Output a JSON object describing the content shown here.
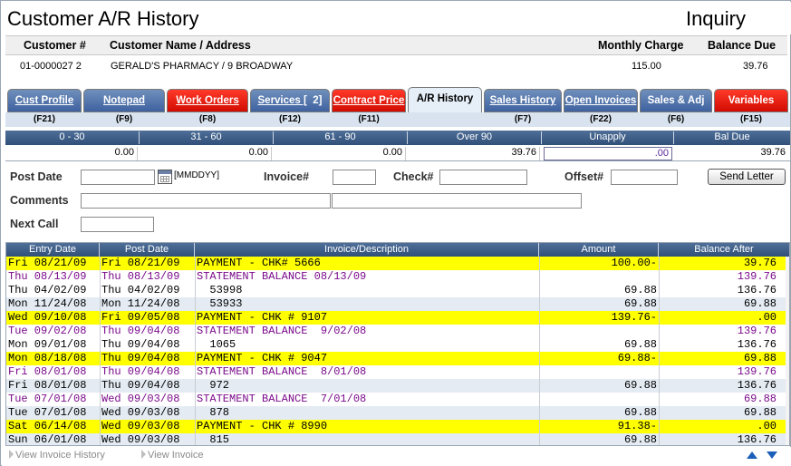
{
  "window": {
    "title": "Customer A/R History",
    "mode": "Inquiry"
  },
  "customer": {
    "headers": {
      "number": "Customer #",
      "name": "Customer Name / Address",
      "monthly_charge": "Monthly Charge",
      "balance_due": "Balance Due"
    },
    "number": "01-0000027 2",
    "name_address": "GERALD'S PHARMACY  /  9 BROADWAY",
    "monthly_charge": "115.00",
    "balance_due": "39.76"
  },
  "tabs": [
    {
      "label": "Cust Profile",
      "fkey": "(F21)"
    },
    {
      "label": "Notepad",
      "fkey": "(F9)"
    },
    {
      "label": "Work Orders",
      "fkey": "(F8)"
    },
    {
      "label": "Services [",
      "badge": "2]",
      "fkey": "(F12)"
    },
    {
      "label": "Contract Price",
      "fkey": "(F11)"
    },
    {
      "label": "A/R History",
      "fkey": ""
    },
    {
      "label": "Sales History",
      "fkey": "(F7)"
    },
    {
      "label": "Open Invoices",
      "fkey": "(F22)"
    },
    {
      "label": "Sales & Adj",
      "fkey": "(F6)"
    },
    {
      "label": "Variables",
      "fkey": "(F15)"
    }
  ],
  "aging": {
    "headers": [
      "0 - 30",
      "31 - 60",
      "61 - 90",
      "Over 90",
      "Unapply",
      "Bal Due"
    ],
    "values": [
      "0.00",
      "0.00",
      "0.00",
      "39.76",
      ".00",
      "39.76"
    ]
  },
  "form": {
    "post_date_label": "Post Date",
    "post_date_value": "",
    "date_format_hint": "[MMDDYY]",
    "invoice_label": "Invoice#",
    "invoice_value": "",
    "check_label": "Check#",
    "check_value": "",
    "offset_label": "Offset#",
    "offset_value": "",
    "send_letter_label": "Send Letter",
    "comments_label": "Comments",
    "comments_value_1": "",
    "comments_value_2": "",
    "next_call_label": "Next Call",
    "next_call_value": ""
  },
  "grid": {
    "headers": [
      "Entry Date",
      "Post Date",
      "Invoice/Description",
      "Amount",
      "Balance After"
    ],
    "rows": [
      {
        "entry": "Fri 08/21/09",
        "post": "Fri 08/21/09",
        "desc": "PAYMENT - CHK# 5666",
        "amount": "100.00-",
        "balance": "39.76",
        "style": "yellow"
      },
      {
        "entry": "Thu 08/13/09",
        "post": "Thu 08/13/09",
        "desc": "STATEMENT BALANCE 08/13/09",
        "amount": "",
        "balance": "139.76",
        "style": "stmt"
      },
      {
        "entry": "Thu 04/02/09",
        "post": "Thu 04/02/09",
        "desc": "  53998",
        "amount": "69.88",
        "balance": "136.76",
        "style": "norm"
      },
      {
        "entry": "Mon 11/24/08",
        "post": "Mon 11/24/08",
        "desc": "  53933",
        "amount": "69.88",
        "balance": "69.88",
        "style": "alt"
      },
      {
        "entry": "Wed 09/10/08",
        "post": "Fri 09/05/08",
        "desc": "PAYMENT - CHK # 9107",
        "amount": "139.76-",
        "balance": ".00",
        "style": "yellow"
      },
      {
        "entry": "Tue 09/02/08",
        "post": "Thu 09/04/08",
        "desc": "STATEMENT BALANCE  9/02/08",
        "amount": "",
        "balance": "139.76",
        "style": "stmt"
      },
      {
        "entry": "Mon 09/01/08",
        "post": "Thu 09/04/08",
        "desc": "  1065",
        "amount": "69.88",
        "balance": "136.76",
        "style": "norm"
      },
      {
        "entry": "Mon 08/18/08",
        "post": "Thu 09/04/08",
        "desc": "PAYMENT - CHK # 9047",
        "amount": "69.88-",
        "balance": "69.88",
        "style": "yellow"
      },
      {
        "entry": "Fri 08/01/08",
        "post": "Thu 09/04/08",
        "desc": "STATEMENT BALANCE  8/01/08",
        "amount": "",
        "balance": "139.76",
        "style": "stmt"
      },
      {
        "entry": "Fri 08/01/08",
        "post": "Thu 09/04/08",
        "desc": "  972",
        "amount": "69.88",
        "balance": "136.76",
        "style": "alt"
      },
      {
        "entry": "Tue 07/01/08",
        "post": "Wed 09/03/08",
        "desc": "STATEMENT BALANCE  7/01/08",
        "amount": "",
        "balance": "69.88",
        "style": "stmt"
      },
      {
        "entry": "Tue 07/01/08",
        "post": "Wed 09/03/08",
        "desc": "  878",
        "amount": "69.88",
        "balance": "69.88",
        "style": "alt"
      },
      {
        "entry": "Sat 06/14/08",
        "post": "Wed 09/03/08",
        "desc": "PAYMENT - CHK # 8990",
        "amount": "91.38-",
        "balance": ".00",
        "style": "yellow"
      },
      {
        "entry": "Sun 06/01/08",
        "post": "Wed 09/03/08",
        "desc": "  815",
        "amount": "69.88",
        "balance": "136.76",
        "style": "alt"
      }
    ]
  },
  "footer": {
    "view_history_label": "View Invoice History",
    "view_invoice_label": "View Invoice",
    "up_icon": "arrow-up-icon",
    "down_icon": "arrow-down-icon"
  },
  "colors": {
    "payment_row": "#ffff00",
    "statement_text": "#7a0a8a",
    "tab_blue": "#3f62a0",
    "tab_red": "#d10b00"
  }
}
